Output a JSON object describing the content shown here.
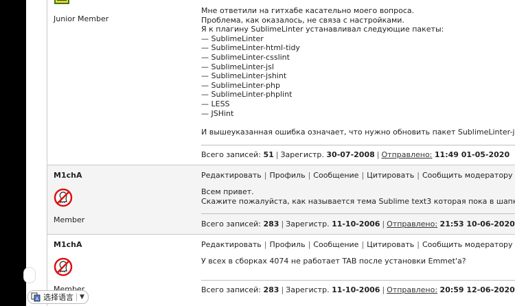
{
  "post1": {
    "rank": "Junior Member",
    "lines": [
      "Мне ответили на гитхабе касательно моего вопроса.",
      "Проблема, как оказалось, не связа с настройками.",
      "Я к плагину SublimeLinter устанавливал следующие пакеты:",
      "— SublimeLinter",
      "— SublimeLinter-html-tidy",
      "— SublimeLinter-csslint",
      "— SublimeLinter-jsl",
      "— SublimeLinter-jshint",
      "— SublimeLinter-php",
      "— SublimeLinter-phplint",
      "— LESS",
      "— JSHint",
      "",
      "И вышеуказанная ошибка означает, что нужно обновить пакет SublimeLinter-js"
    ],
    "meta": {
      "posts_label": "Всего записей:",
      "posts": "51",
      "reg_label": "Зарегистр.",
      "reg": "30-07-2008",
      "sent_label": "Отправлено:",
      "sent": "11:49 01-05-2020"
    }
  },
  "post2": {
    "author": "M1chA",
    "rank": "Member",
    "actions": [
      "Редактировать",
      "Профиль",
      "Сообщение",
      "Цитировать",
      "Сообщить модератору"
    ],
    "lines": [
      "Всем привет.",
      "Скажите пожалуйста, как называется тема Sublime text3 которая пока в шапке"
    ],
    "meta": {
      "posts_label": "Всего записей:",
      "posts": "283",
      "reg_label": "Зарегистр.",
      "reg": "11-10-2006",
      "sent_label": "Отправлено:",
      "sent": "21:53 10-06-2020"
    }
  },
  "post3": {
    "author": "M1chA",
    "rank": "Member",
    "actions": [
      "Редактировать",
      "Профиль",
      "Сообщение",
      "Цитировать",
      "Сообщить модератору"
    ],
    "lines": [
      "У всех в сборках 4074 не работает TAB после установки Emmet'a?"
    ],
    "meta": {
      "posts_label": "Всего записей:",
      "posts": "283",
      "reg_label": "Зарегистр.",
      "reg": "11-10-2006",
      "sent_label": "Отправлено:",
      "sent": "20:59 12-06-2020"
    }
  },
  "lang_widget": {
    "label": "选择语言",
    "arrow": "▼"
  },
  "icons": {
    "ghostbusters": "ghostbusters-avatar-icon",
    "junior": "folder-avatar-icon",
    "translate": "translate-icon"
  }
}
